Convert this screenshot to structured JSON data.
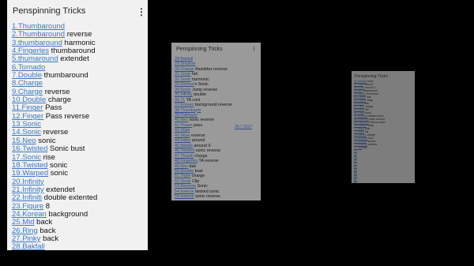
{
  "main": {
    "title": "Penspinning Tricks",
    "menu_icon": "more-vert-icon",
    "items": [
      {
        "link": "1.Thumbaround",
        "rest": ""
      },
      {
        "link": "2.Thumbaround",
        "rest": " reverse"
      },
      {
        "link": "3.thumbaround",
        "rest": " harmonic"
      },
      {
        "link": "4.Fingerles",
        "rest": " thumbaround"
      },
      {
        "link": "5.thumaround",
        "rest": " extendet"
      },
      {
        "link": "6.Tornado",
        "rest": ""
      },
      {
        "link": "7.Double",
        "rest": " thumbaround"
      },
      {
        "link": "8.Charge",
        "rest": ""
      },
      {
        "link": "9.Charge",
        "rest": " reverse"
      },
      {
        "link": "10.Double",
        "rest": " charge"
      },
      {
        "link": "11.Finger",
        "rest": "  Pass"
      },
      {
        "link": "12.Finger",
        "rest": " Pass reverse"
      },
      {
        "link": "13.Sonic",
        "rest": ""
      },
      {
        "link": "14.Sonic",
        "rest": " reverse"
      },
      {
        "link": "15.Neo",
        "rest": " sonic"
      },
      {
        "link": "16.Twisted",
        "rest": " Sonic bust"
      },
      {
        "link": "17.Sonic",
        "rest": " rise"
      },
      {
        "link": "18.Twisted",
        "rest": " sonic"
      },
      {
        "link": "19.Warped",
        "rest": " sonic"
      },
      {
        "link": "20.Infinity",
        "rest": ""
      },
      {
        "link": "21.Infinity",
        "rest": " extendet"
      },
      {
        "link": "22.Infiniti",
        "rest": " double extented"
      },
      {
        "link": "23.Figure",
        "rest": " 8"
      },
      {
        "link": "24.Korean",
        "rest": " background"
      },
      {
        "link": "25.Mid",
        "rest": " back"
      },
      {
        "link": "26.Ring",
        "rest": " back"
      },
      {
        "link": "27.Pinky",
        "rest": " back"
      },
      {
        "link": "28.Bakfall",
        "rest": ""
      }
    ]
  },
  "middle": {
    "title": "Penspinning Tricks",
    "menu_icon": "more-vert-icon",
    "date_stamp": "20.7.2017",
    "items": [
      {
        "link": "28.Bakfall",
        "rest": ""
      },
      {
        "link": "29.Shadow",
        "rest": ""
      },
      {
        "link": "30.Charge",
        "rest": " thumblez reverse"
      },
      {
        "link": "31.Sonic",
        "rest": " fall"
      },
      {
        "link": "32.Sonic",
        "rest": " harmonic"
      },
      {
        "link": "33.Demon",
        "rest": "'s Sonic"
      },
      {
        "link": "34.Sonic",
        "rest": " Jump reverse"
      },
      {
        "link": "35.Infinity",
        "rest": " double"
      },
      {
        "link": "36.71",
        "rest": " TA cont"
      },
      {
        "link": "37.Korean",
        "rest": " background reverse"
      },
      {
        "link": "38.Thumbspin",
        "rest": ""
      },
      {
        "link": "39.Palmspin",
        "rest": ""
      },
      {
        "link": "40.Neo",
        "rest": " sonic reverse"
      },
      {
        "link": "41.Power",
        "rest": " pass"
      },
      {
        "link": "42.Wipe",
        "rest": ""
      },
      {
        "link": "43.Wipe",
        "rest": " reverse"
      },
      {
        "link": "44.Index",
        "rest": " around"
      },
      {
        "link": "45.Middle",
        "rest": " around  X"
      },
      {
        "link": "46.Twisted",
        "rest": " sonic reverse"
      },
      {
        "link": "47.Thumb",
        "rest": " charge"
      },
      {
        "link": "48.Fingerles",
        "rest": " TA reverse"
      },
      {
        "link": "49.Neo",
        "rest": " bak"
      },
      {
        "link": "50.Double",
        "rest": " bust"
      },
      {
        "link": "51.Triple",
        "rest": " charge"
      },
      {
        "link": "52.Sonic",
        "rest": " Clip"
      },
      {
        "link": "53.Reverse",
        "rest": " Sonic"
      },
      {
        "link": "54.Inverse",
        "rest": " twisted sonic"
      },
      {
        "link": "55.Inverse",
        "rest": " sonic reverse"
      }
    ]
  },
  "right": {
    "title": "Penspinning Tricks",
    "menu_icon": "more-vert-icon",
    "items": [
      {
        "link": "56.Inverse",
        "rest": " sonic"
      },
      {
        "link": "57.Pass",
        "rest": " around"
      },
      {
        "link": "58.Sonic",
        "rest": " around 1"
      },
      {
        "link": "59.Neo",
        "rest": " backaround"
      },
      {
        "link": "60.Infinity",
        "rest": " TA reverse"
      },
      {
        "link": "61.Thumb",
        "rest": " bak"
      },
      {
        "link": "62.Thumb",
        "rest": " swap"
      },
      {
        "link": "63.Wipe",
        "rest": " bak"
      },
      {
        "link": "64.Triple",
        "rest": " charge"
      },
      {
        "link": "65.Sonic",
        "rest": " fall"
      },
      {
        "link": "66.Pinky",
        "rest": " sonic"
      },
      {
        "link": "67.Reverse",
        "rest": " twisted sonic"
      },
      {
        "link": "68.Extended",
        "rest": " wipe reverse"
      },
      {
        "link": "69.Extended",
        "rest": " inverse sonic"
      },
      {
        "link": "70.Twisted",
        "rest": " sonic"
      },
      {
        "link": "71.Index",
        "rest": " bust"
      },
      {
        "link": "72.Index",
        "rest": " fall"
      },
      {
        "link": "73.Inverse",
        "rest": " charge"
      },
      {
        "link": "74.Reverse",
        "rest": " bust"
      },
      {
        "link": "75.Charge",
        "rest": " around"
      },
      {
        "link": "76.Shadow",
        "rest": " reverse"
      },
      {
        "link": "77.Mid",
        "rest": " bak"
      },
      {
        "link": "78",
        "rest": ""
      },
      {
        "link": "79",
        "rest": ""
      },
      {
        "link": "80",
        "rest": ""
      },
      {
        "link": "81",
        "rest": ""
      },
      {
        "link": "82",
        "rest": ""
      },
      {
        "link": "83",
        "rest": ""
      },
      {
        "link": "84",
        "rest": ""
      },
      {
        "link": "85",
        "rest": ""
      },
      {
        "link": "86",
        "rest": ""
      },
      {
        "link": "87",
        "rest": ""
      },
      {
        "link": "88",
        "rest": ""
      }
    ]
  }
}
